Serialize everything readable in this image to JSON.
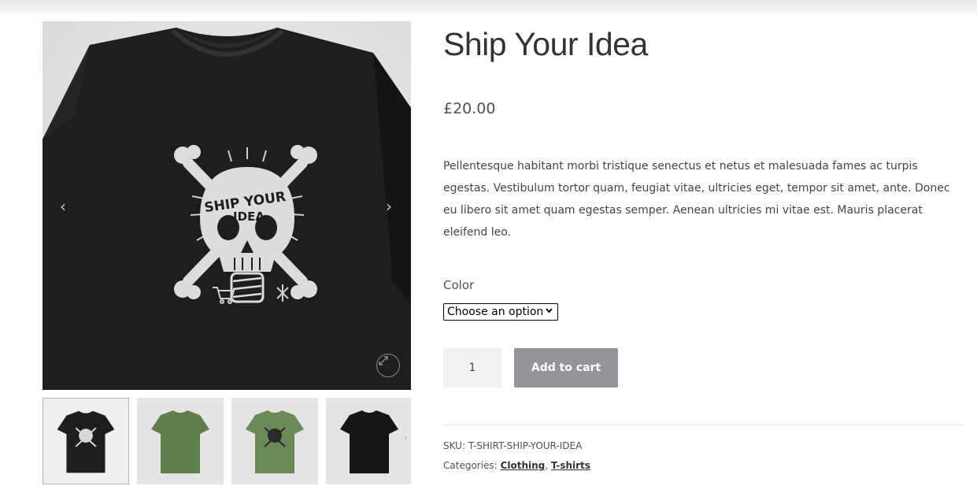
{
  "product": {
    "title": "Ship Your Idea",
    "price": "£20.00",
    "description": "Pellentesque habitant morbi tristique senectus et netus et malesuada fames ac turpis egestas. Vestibulum tortor quam, feugiat vitae, ultricies eget, tempor sit amet, ante. Donec eu libero sit amet quam egestas semper. Aenean ultricies mi vitae est. Mauris placerat eleifend leo.",
    "color_label": "Color",
    "color_select_value": "Choose an option",
    "quantity": "1",
    "add_to_cart_label": "Add to cart",
    "sku_label": "SKU:",
    "sku_value": "T-SHIRT-SHIP-YOUR-IDEA",
    "categories_label": "Categories:",
    "categories": [
      "Clothing",
      "T-shirts"
    ],
    "categories_separator": ","
  },
  "gallery": {
    "prev_arrow": "‹",
    "next_arrow": "›",
    "thumb_next_arrow": "›",
    "print_text_line1": "SHIP YOUR",
    "print_text_line2": "IDEA",
    "thumbnails": [
      {
        "shirt_color": "#1e1e1e",
        "has_print": true
      },
      {
        "shirt_color": "#5f7f4a",
        "has_print": false
      },
      {
        "shirt_color": "#6a8a58",
        "has_print": true
      },
      {
        "shirt_color": "#161616",
        "has_print": false
      }
    ]
  },
  "colors": {
    "button_bg": "#959599",
    "shirt_black": "#1e1e1e",
    "text": "#43454b"
  }
}
